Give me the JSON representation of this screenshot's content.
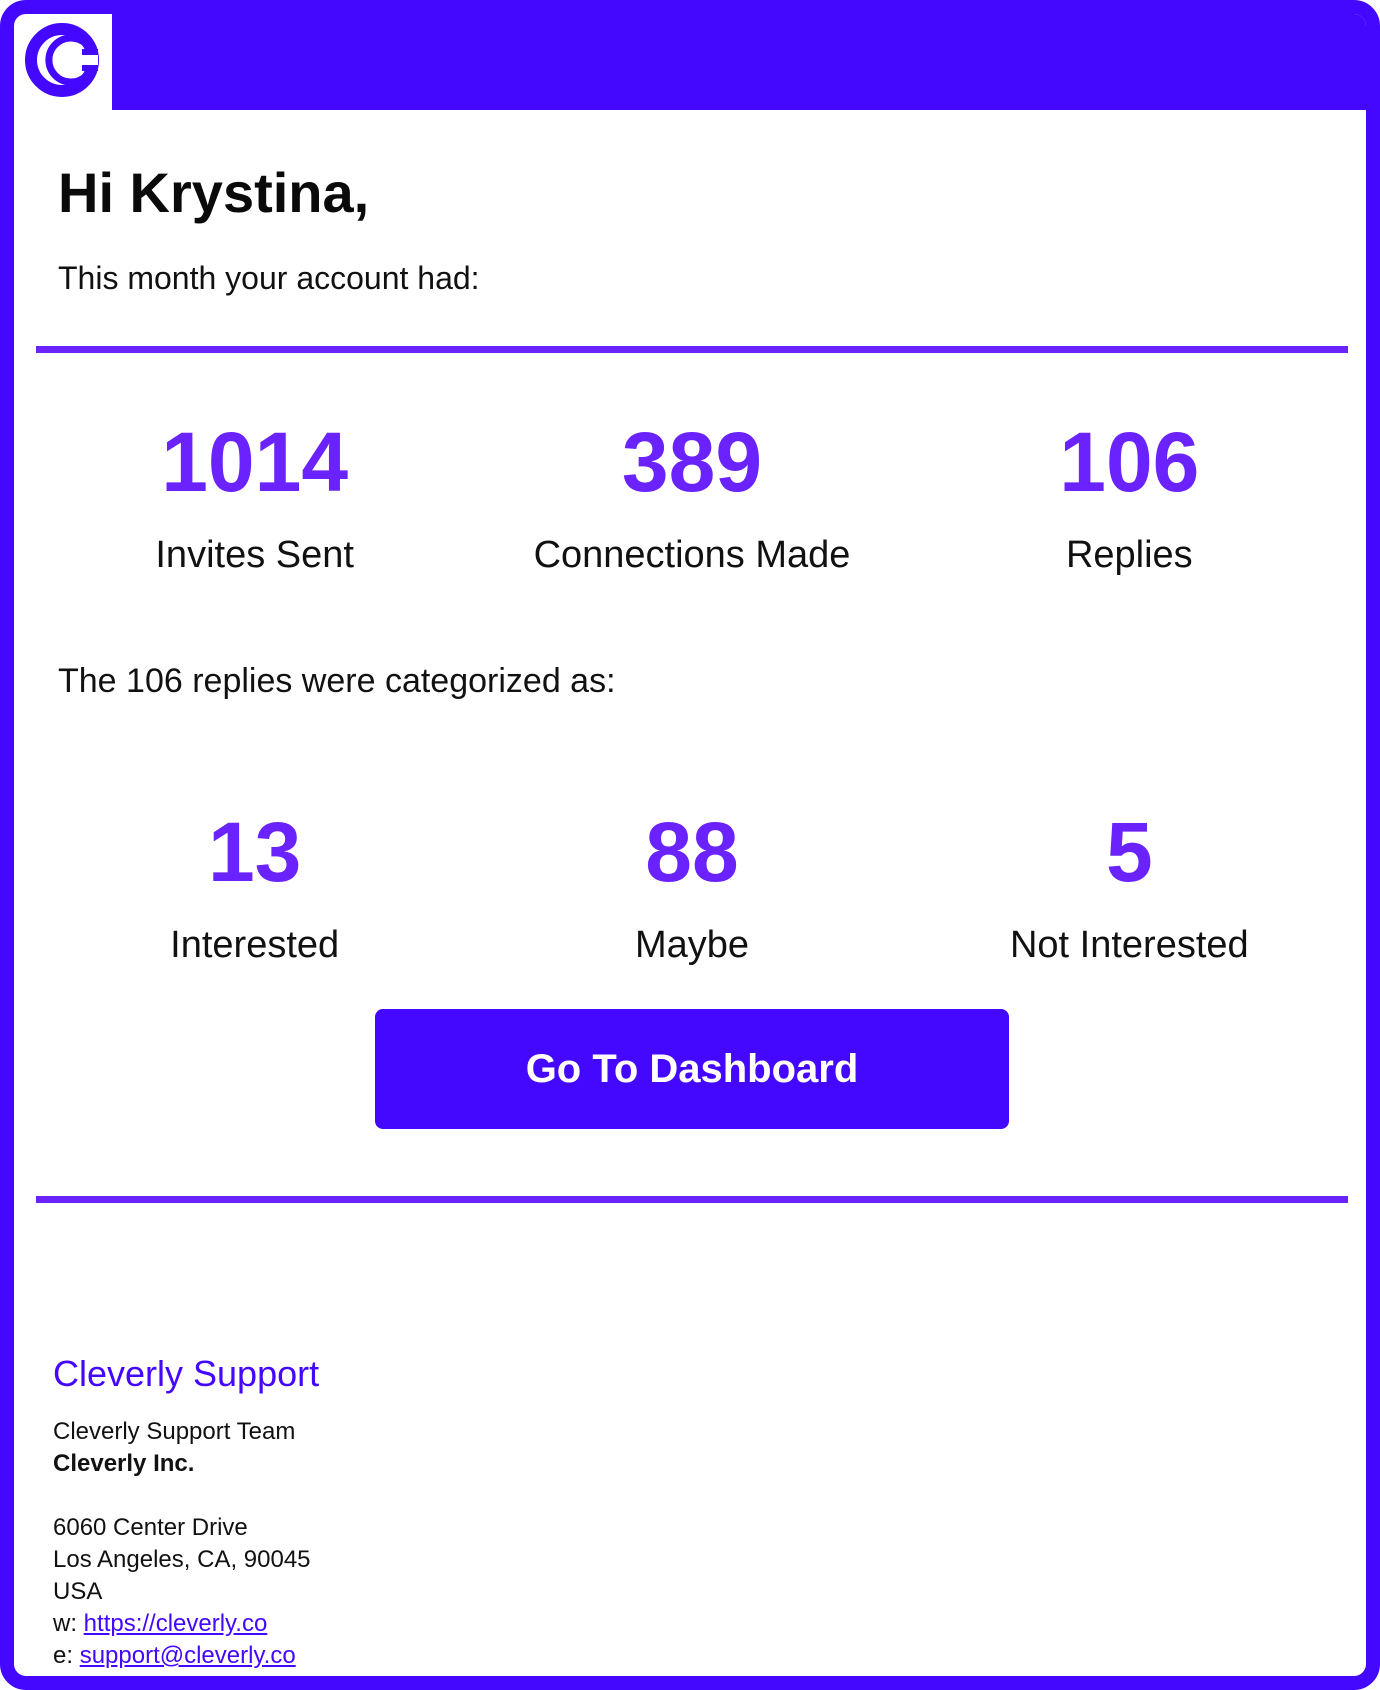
{
  "brand": {
    "accent_color": "#4407ff",
    "stat_color": "#6a22ff",
    "logo_icon": "cleverly-c-logo"
  },
  "greeting": "Hi Krystina,",
  "intro": "This month your account had:",
  "stats": [
    {
      "value": "1014",
      "label": "Invites Sent"
    },
    {
      "value": "389",
      "label": "Connections Made"
    },
    {
      "value": "106",
      "label": "Replies"
    }
  ],
  "replies_intro": "The 106 replies were categorized as:",
  "categories": [
    {
      "value": "13",
      "label": "Interested"
    },
    {
      "value": "88",
      "label": "Maybe"
    },
    {
      "value": "5",
      "label": "Not Interested"
    }
  ],
  "cta": {
    "label": "Go To Dashboard"
  },
  "footer": {
    "title": "Cleverly Support",
    "team": "Cleverly Support Team",
    "company": "Cleverly Inc.",
    "address_line1": "6060 Center Drive",
    "address_line2": "Los Angeles, CA, 90045",
    "country": "USA",
    "website_prefix": "w: ",
    "website": "https://cleverly.co",
    "email_prefix": "e: ",
    "email": "support@cleverly.co"
  }
}
